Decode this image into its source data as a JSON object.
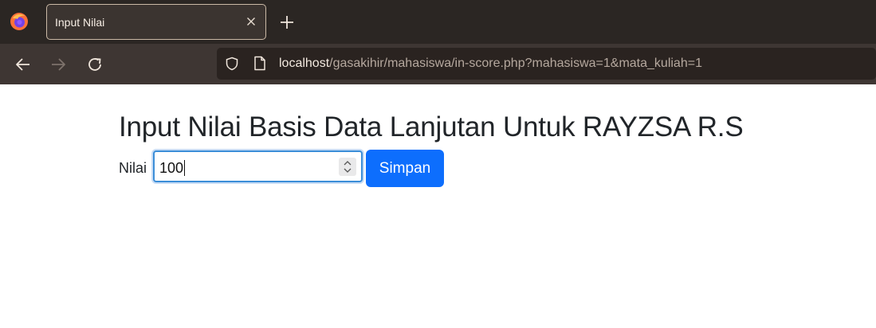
{
  "browser": {
    "tab": {
      "title": "Input Nilai"
    },
    "url": {
      "host": "localhost",
      "path": "/gasakihir/mahasiswa/in-score.php?mahasiswa=1&mata_kuliah=1"
    },
    "icons": {
      "logo": "firefox-icon",
      "close": "close-icon",
      "new_tab": "plus-icon",
      "back": "arrow-left-icon",
      "forward": "arrow-right-icon",
      "reload": "reload-icon",
      "shield": "shield-icon",
      "page": "page-icon"
    }
  },
  "page": {
    "title": "Input Nilai Basis Data Lanjutan Untuk RAYZSA R.S",
    "form": {
      "label": "Nilai",
      "value": "100",
      "submit_label": "Simpan"
    }
  },
  "colors": {
    "primary_button": "#0d6efd",
    "tabbar_bg": "#2b2623",
    "navbar_bg": "#3e3633",
    "input_focus_border": "#3b8ed8"
  }
}
